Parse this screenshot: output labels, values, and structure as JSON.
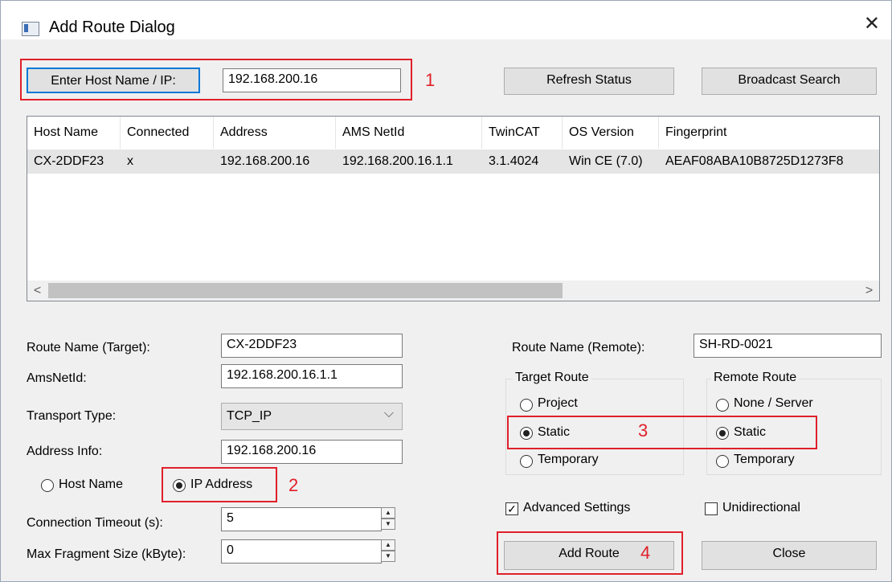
{
  "window": {
    "title": "Add Route Dialog"
  },
  "search": {
    "host_button_label": "Enter Host Name / IP:",
    "host_value": "192.168.200.16",
    "refresh_label": "Refresh Status",
    "broadcast_label": "Broadcast Search"
  },
  "table": {
    "columns": [
      "Host Name",
      "Connected",
      "Address",
      "AMS NetId",
      "TwinCAT",
      "OS Version",
      "Fingerprint"
    ],
    "rows": [
      [
        "CX-2DDF23",
        "x",
        "192.168.200.16",
        "192.168.200.16.1.1",
        "3.1.4024",
        "Win CE (7.0)",
        "AEAF08ABA10B8725D1273F8"
      ]
    ]
  },
  "left_form": {
    "route_name_label": "Route Name (Target):",
    "route_name_value": "CX-2DDF23",
    "amsnetid_label": "AmsNetId:",
    "amsnetid_value": "192.168.200.16.1.1",
    "transport_label": "Transport Type:",
    "transport_value": "TCP_IP",
    "address_label": "Address Info:",
    "address_value": "192.168.200.16",
    "host_name_radio": "Host Name",
    "ip_address_radio": "IP Address",
    "timeout_label": "Connection Timeout (s):",
    "timeout_value": "5",
    "fragment_label": "Max Fragment Size (kByte):",
    "fragment_value": "0"
  },
  "right_form": {
    "remote_name_label": "Route Name (Remote):",
    "remote_name_value": "SH-RD-0021",
    "target_route_title": "Target Route",
    "target_project": "Project",
    "target_static": "Static",
    "target_temporary": "Temporary",
    "remote_route_title": "Remote Route",
    "remote_none": "None / Server",
    "remote_static": "Static",
    "remote_temporary": "Temporary",
    "advanced_label": "Advanced Settings",
    "unidirectional_label": "Unidirectional",
    "add_route_label": "Add Route",
    "close_label": "Close"
  },
  "annotations": [
    "1",
    "2",
    "3",
    "4"
  ],
  "colors": {
    "annotation": "#e0202a",
    "focus_border": "#0078d7"
  }
}
